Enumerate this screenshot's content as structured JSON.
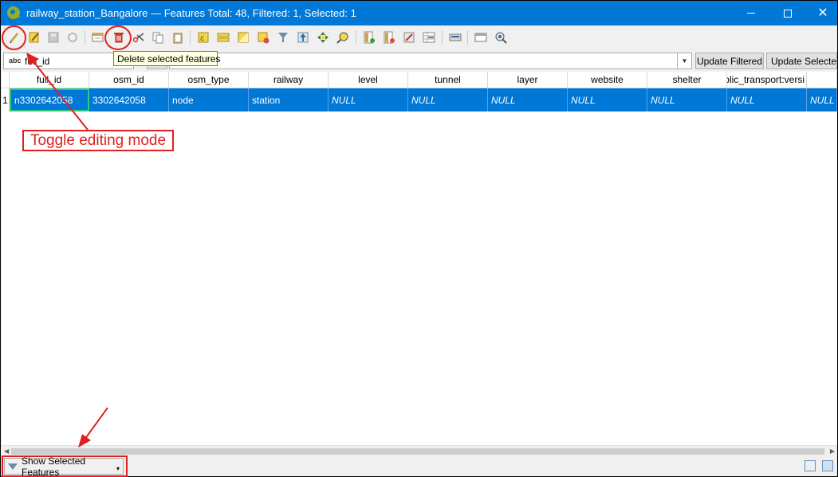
{
  "window": {
    "title": "railway_station_Bangalore — Features Total: 48, Filtered: 1, Selected: 1",
    "logo_icon": "qgis-logo-icon",
    "controls": [
      "minimize-icon",
      "maximize-icon",
      "close-icon"
    ]
  },
  "toolbar": {
    "icons": [
      "toggle-editing-icon",
      "multi-edit-icon",
      "save-edits-icon",
      "reload-icon",
      "add-feature-icon",
      "delete-selected-icon",
      "cut-icon",
      "copy-icon",
      "paste-icon",
      "expression-select-icon",
      "select-all-icon",
      "invert-selection-icon",
      "deselect-all-icon",
      "filter-select-icon",
      "move-selection-top-icon",
      "pan-to-selection-icon",
      "zoom-to-selection-icon",
      "new-field-icon",
      "delete-field-icon",
      "field-calculator-icon",
      "conditional-format-icon",
      "actions-icon",
      "dock-icon",
      "search-settings-icon"
    ]
  },
  "filter": {
    "field_type_badge": "abc",
    "field_value": "full_id",
    "expression_value": "",
    "update_filtered_label": "Update Filtered",
    "update_selected_label": "Update Selected"
  },
  "tooltip": {
    "text": "Delete selected features"
  },
  "table": {
    "columns": [
      "full_id",
      "osm_id",
      "osm_type",
      "railway",
      "level",
      "tunnel",
      "layer",
      "website",
      "shelter",
      "blic_transport:versi",
      ""
    ],
    "rows": [
      {
        "row_number": "1",
        "cells": [
          "n3302642058",
          "3302642058",
          "node",
          "station",
          "NULL",
          "NULL",
          "NULL",
          "NULL",
          "NULL",
          "NULL",
          "NULL"
        ]
      }
    ]
  },
  "statusbar": {
    "show_features_label": "Show Selected Features",
    "icons": [
      "form-view-icon",
      "table-view-icon"
    ]
  },
  "annotations": {
    "callout_text": "Toggle editing mode",
    "color": "#e02020"
  },
  "colors": {
    "titlebar": "#0078d7",
    "selection": "#0078d7",
    "current_cell_border": "#2ec97a",
    "tooltip_bg": "#ffffe1"
  }
}
